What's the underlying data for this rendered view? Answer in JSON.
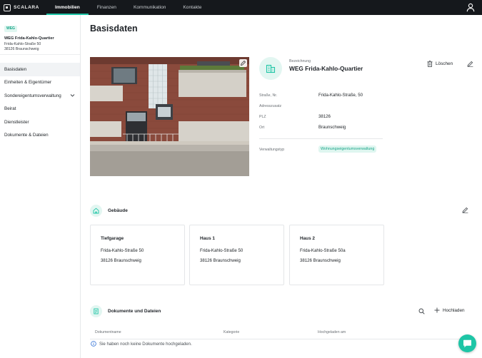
{
  "brand": {
    "name": "SCALARA",
    "accent": "#1ec5a6",
    "topbar_bg": "#15181c"
  },
  "nav": {
    "tabs": [
      {
        "label": "Immobilien",
        "active": true
      },
      {
        "label": "Finanzen",
        "active": false
      },
      {
        "label": "Kommunikation",
        "active": false
      },
      {
        "label": "Kontakte",
        "active": false
      }
    ],
    "user_icon": "user-icon"
  },
  "sidebar": {
    "badge": "WEG",
    "property_name": "WEG Frida-Kahlo-Quartier",
    "street": "Frida-Kahlo-Straße 50",
    "city": "38126 Braunschweig",
    "items": [
      {
        "label": "Basisdaten",
        "active": true
      },
      {
        "label": "Einheiten & Eigentümer"
      },
      {
        "label": "Sondereigentumsverwaltung",
        "icon": "chevron-down-icon"
      },
      {
        "label": "Beirat"
      },
      {
        "label": "Dienstleister"
      },
      {
        "label": "Dokumente & Dateien"
      }
    ]
  },
  "page": {
    "title": "Basisdaten"
  },
  "details": {
    "bezeichnung_label": "Bezeichnung",
    "bezeichnung": "WEG Frida-Kahlo-Quartier",
    "delete_label": "Löschen",
    "fields": [
      {
        "label": "Straße, Nr.",
        "value": "Frida-Kahlo-Straße, 50"
      },
      {
        "label": "Adresszusatz",
        "value": ""
      },
      {
        "label": "PLZ",
        "value": "38126"
      },
      {
        "label": "Ort",
        "value": "Braunschweig"
      }
    ],
    "verwaltungstyp_label": "Verwaltungstyp",
    "verwaltungstyp": "Wohnungseigentumsverwaltung"
  },
  "gebaeude": {
    "title": "Gebäude",
    "cards": [
      {
        "name": "Tiefgarage",
        "street": "Frida-Kahlo-Straße 50",
        "city": "38126 Braunschweig"
      },
      {
        "name": "Haus 1",
        "street": "Frida-Kahlo-Straße 50",
        "city": "38126 Braunschweig"
      },
      {
        "name": "Haus 2",
        "street": "Frida-Kahlo-Straße 50a",
        "city": "38126 Braunschweig"
      }
    ]
  },
  "dokumente": {
    "title": "Dokumente und Dateien",
    "upload_label": "Hochladen",
    "columns": [
      "Dokumentname",
      "Kategorie",
      "Hochgeladen am"
    ],
    "empty_message": "Sie haben noch keine Dokumente hochgeladen."
  }
}
